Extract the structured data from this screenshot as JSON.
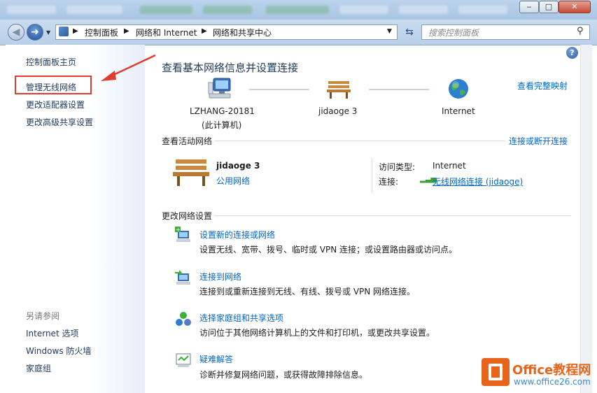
{
  "window": {
    "minimize_glyph": "‒",
    "maximize_glyph": "□",
    "close_glyph": "✕"
  },
  "address_bar": {
    "breadcrumb": [
      "控制面板",
      "网络和 Internet",
      "网络和共享中心"
    ],
    "search_placeholder": "搜索控制面板"
  },
  "sidebar": {
    "items": [
      {
        "label": "控制面板主页"
      },
      {
        "label": "管理无线网络"
      },
      {
        "label": "更改适配器设置"
      },
      {
        "label": "更改高级共享设置"
      }
    ],
    "see_also_title": "另请参阅",
    "see_also": [
      {
        "label": "Internet 选项"
      },
      {
        "label": "Windows 防火墙"
      },
      {
        "label": "家庭组"
      }
    ]
  },
  "main": {
    "title": "查看基本网络信息并设置连接",
    "view_full_map": "查看完整映射",
    "map": {
      "computer_name": "LZHANG-20181",
      "computer_sub": "(此计算机)",
      "network_name": "jidaoge  3",
      "internet": "Internet"
    },
    "active_section": {
      "title": "查看活动网络",
      "connect_link": "连接或断开连接",
      "network_name": "jidaoge  3",
      "network_type": "公用网络",
      "access_type_label": "访问类型:",
      "access_type_value": "Internet",
      "connection_label": "连接:",
      "connection_value": "无线网络连接 (jidaoge)"
    },
    "change_section": {
      "title": "更改网络设置",
      "items": [
        {
          "title": "设置新的连接或网络",
          "desc": "设置无线、宽带、拨号、临时或 VPN 连接；或设置路由器或访问点。"
        },
        {
          "title": "连接到网络",
          "desc": "连接到或重新连接到无线、有线、拨号或 VPN 网络连接。"
        },
        {
          "title": "选择家庭组和共享选项",
          "desc": "访问位于其他网络计算机上的文件和打印机，或更改共享设置。"
        },
        {
          "title": "疑难解答",
          "desc": "诊断并修复网络问题，或获得故障排除信息。"
        }
      ]
    }
  },
  "watermark": {
    "brand": "Office教程网",
    "url": "www.office26.com"
  },
  "colors": {
    "link": "#0066cc",
    "heading": "#1e395b",
    "annotation": "#e03c31",
    "watermark_orange": "#e8641b"
  }
}
